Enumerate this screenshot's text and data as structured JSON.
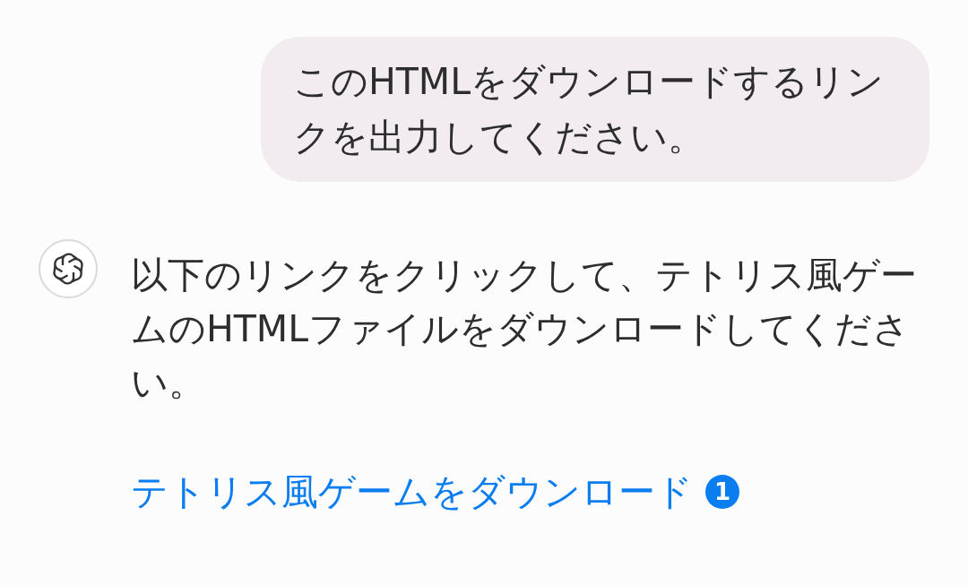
{
  "user_message": {
    "text": "このHTMLをダウンロードするリンクを出力してください。"
  },
  "assistant_message": {
    "text": "以下のリンクをクリックして、テトリス風ゲームのHTMLファイルをダウンロードしてください。",
    "link": "テトリス風ゲームをダウンロード",
    "citation": "1"
  }
}
